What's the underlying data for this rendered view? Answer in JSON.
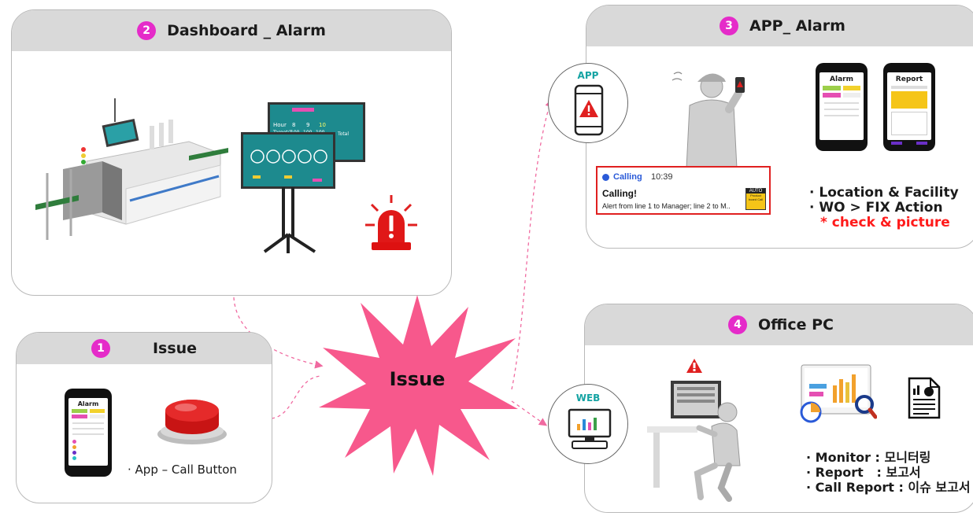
{
  "panels": {
    "dashboard": {
      "number": "2",
      "title": "Dashboard _ Alarm"
    },
    "app": {
      "number": "3",
      "title": "APP_ Alarm"
    },
    "issue": {
      "number": "1",
      "title": "Issue"
    },
    "office": {
      "number": "4",
      "title": "Office PC"
    }
  },
  "center": {
    "label": "Issue"
  },
  "app_circle": {
    "label": "APP"
  },
  "web_circle": {
    "label": "WEB"
  },
  "issue_panel": {
    "bullet": "· App – Call Button"
  },
  "phone_screens": {
    "alarm": "Alarm",
    "report": "Report",
    "issue_phone_title": "Alarm"
  },
  "notification": {
    "app_name": "Calling",
    "time": "10:39",
    "title": "Calling!",
    "body": "Alert from line 1 to Manager; line 2 to M..",
    "badge_top": "AUTO",
    "badge_bottom": "Product board Call"
  },
  "app_bullets": {
    "b1": "· Location & Facility",
    "b2": "· WO > FIX Action",
    "b3": "* check & picture"
  },
  "office_bullets": {
    "b1": "· Monitor : 모니터링",
    "b2": "· Report   : 보고서",
    "b3": "· Call Report : 이슈 보고서"
  },
  "dashboard_screen": {
    "hour_label": "Hour",
    "h1": "8",
    "h2": "9",
    "h3": "10",
    "target_label": "Target/1",
    "t1": "100",
    "t2": "100",
    "t3": "100",
    "total_label": "Total"
  },
  "colors": {
    "accent": "#e52bc9",
    "burst": "#f7588c",
    "teal": "#1d8a8e",
    "alert_red": "#ff1b1b"
  }
}
